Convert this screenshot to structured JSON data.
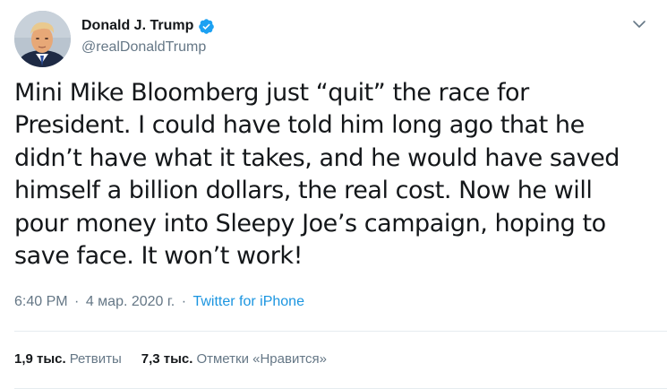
{
  "author": {
    "display_name": "Donald J. Trump",
    "handle": "@realDonaldTrump"
  },
  "tweet": {
    "text": "Mini Mike Bloomberg just “quit” the race for President. I could have told him long ago that he didn’t have what it takes, and he would have saved himself a billion dollars, the real cost. Now he will pour money into Sleepy Joe’s campaign, hoping to save face. It won’t work!"
  },
  "meta": {
    "time": "6:40 PM",
    "date": "4 мар. 2020 г.",
    "separator": "·",
    "source": "Twitter for iPhone"
  },
  "stats": {
    "retweets_count": "1,9 тыс.",
    "retweets_label": "Ретвиты",
    "likes_count": "7,3 тыс.",
    "likes_label": "Отметки «Нравится»"
  },
  "icons": {
    "verified": "verified-badge-icon",
    "caret": "chevron-down-icon"
  },
  "colors": {
    "text": "#14171a",
    "secondary": "#657786",
    "link": "#1b95e0",
    "verified": "#1da1f2",
    "divider": "#e6ecf0"
  }
}
